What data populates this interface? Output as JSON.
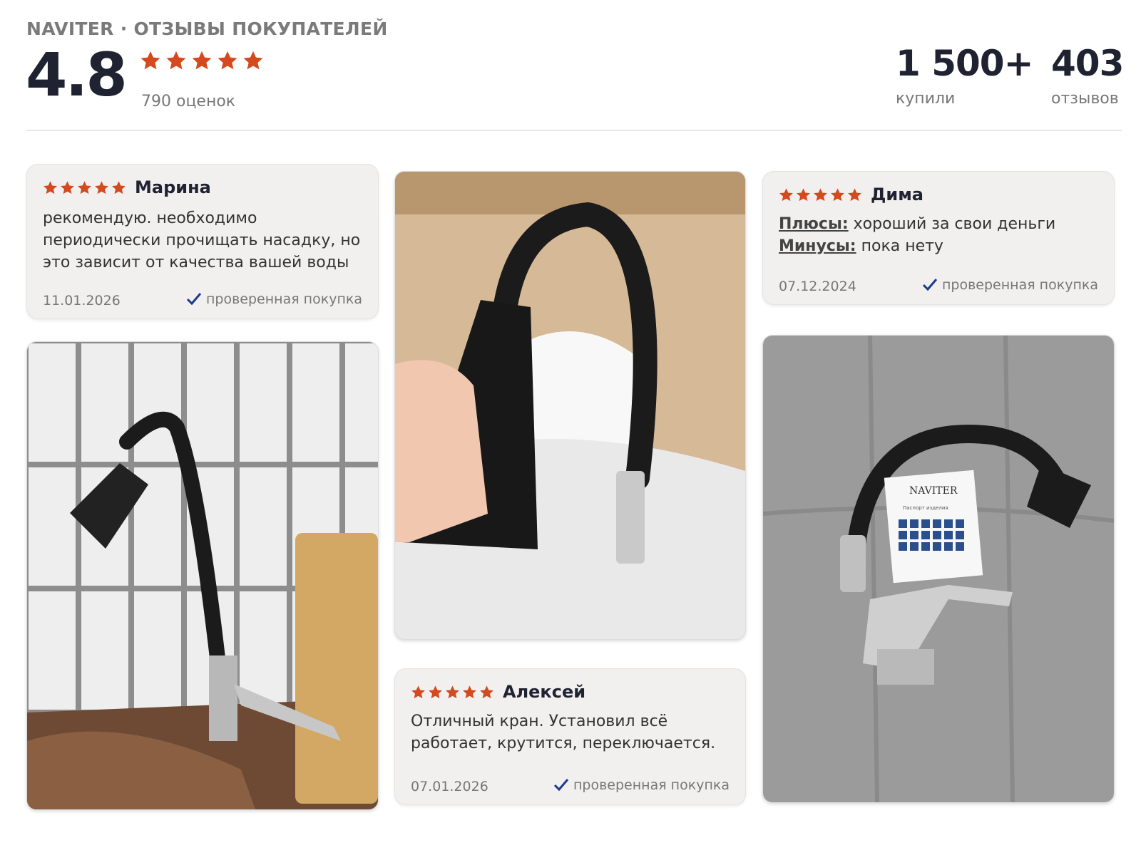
{
  "header": {
    "brand_title": "NAVITER · ОТЗЫВЫ ПОКУПАТЕЛЕЙ",
    "rating": "4.8",
    "rating_stars": 5,
    "ratings_count": "790 оценок",
    "bought_value": "1 500+",
    "bought_label": "купили",
    "reviews_value": "403",
    "reviews_label": "отзывов"
  },
  "colors": {
    "star": "#d4491d",
    "verified_check": "#1e3a8a"
  },
  "reviews": [
    {
      "name": "Марина",
      "stars": 5,
      "text": "рекомендую. необходимо периодически прочищать насадку, но это зависит от качества вашей воды",
      "date": "11.01.2026",
      "verified": "проверенная покупка"
    },
    {
      "name": "Дима",
      "stars": 5,
      "pros_label": "Плюсы:",
      "pros": "хороший за свои деньги",
      "cons_label": "Минусы:",
      "cons": "пока нету",
      "date": "07.12.2024",
      "verified": "проверенная покупка"
    },
    {
      "name": "Алексей",
      "stars": 5,
      "text": "Отличный кран. Установил всё работает, крутится, переключается.",
      "date": "07.01.2026",
      "verified": "проверенная покупка"
    }
  ],
  "photos": [
    {
      "name": "faucet-installed-photo"
    },
    {
      "name": "faucet-in-box-photo"
    },
    {
      "name": "faucet-with-passport-photo",
      "logo_text": "NAVITER",
      "passport_text": "Паспорт изделия"
    }
  ]
}
